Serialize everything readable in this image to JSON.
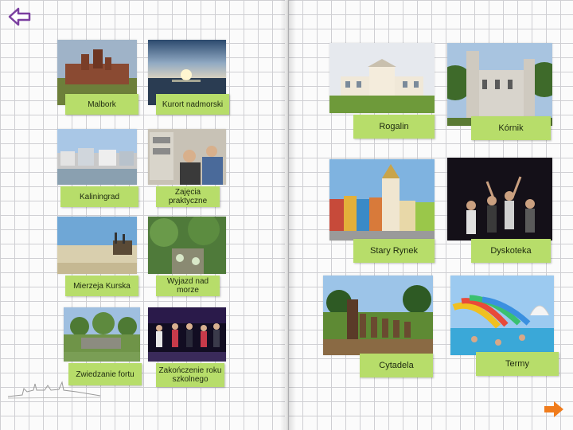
{
  "navigation": {
    "back_icon": "arrow-left-icon",
    "back_color": "#7b3fa0",
    "next_icon": "arrow-right-icon",
    "next_color": "#f07c1c"
  },
  "left_page": {
    "items": [
      {
        "label": "Malbork"
      },
      {
        "label": "Kurort nadmorski"
      },
      {
        "label": "Kaliningrad"
      },
      {
        "label": "Zajęcia praktyczne"
      },
      {
        "label": "Mierzeja Kurska"
      },
      {
        "label": "Wyjazd nad morze"
      },
      {
        "label": "Zwiedzanie fortu"
      },
      {
        "label": "Zakończenie roku\nszkolnego"
      }
    ]
  },
  "right_page": {
    "items": [
      {
        "label": "Rogalin"
      },
      {
        "label": "Kórnik"
      },
      {
        "label": "Stary Rynek"
      },
      {
        "label": "Dyskoteka"
      },
      {
        "label": "Cytadela"
      },
      {
        "label": "Termy"
      }
    ]
  },
  "colors": {
    "label_green": "#b7dd6a",
    "grid_line": "#cfcfd3"
  }
}
